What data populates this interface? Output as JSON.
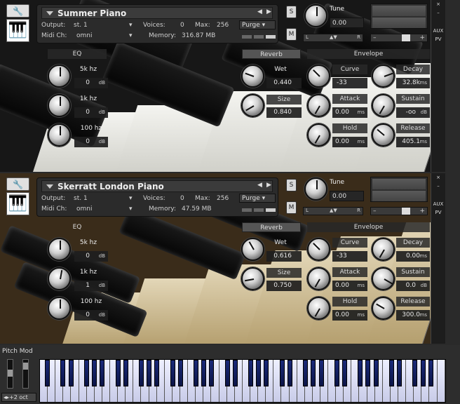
{
  "instruments": [
    {
      "name": "Summer Piano",
      "output": "st. 1",
      "midi_ch": "omni",
      "voices": "0",
      "max": "256",
      "memory": "316.87 MB",
      "purge": "Purge",
      "tune": "0.00",
      "eq": {
        "label": "EQ",
        "bands": [
          {
            "freq": "5k hz",
            "value": "0",
            "unit": "dB"
          },
          {
            "freq": "1k hz",
            "value": "0",
            "unit": "dB"
          },
          {
            "freq": "100 hz",
            "value": "0",
            "unit": "dB"
          }
        ]
      },
      "reverb": {
        "label": "Reverb",
        "wet": "0.440",
        "size": "0.840"
      },
      "curve": "-33",
      "attack": "0.00",
      "hold": "0.00",
      "envelope": {
        "label": "Envelope",
        "decay": "32.8k",
        "sustain": "-oo",
        "release": "405.1"
      }
    },
    {
      "name": "Skerratt London Piano",
      "output": "st. 1",
      "midi_ch": "omni",
      "voices": "0",
      "max": "256",
      "memory": "47.59 MB",
      "purge": "Purge",
      "tune": "0.00",
      "eq": {
        "label": "EQ",
        "bands": [
          {
            "freq": "5k hz",
            "value": "0",
            "unit": "dB"
          },
          {
            "freq": "1k hz",
            "value": "1",
            "unit": "dB"
          },
          {
            "freq": "100 hz",
            "value": "0",
            "unit": "dB"
          }
        ]
      },
      "reverb": {
        "label": "Reverb",
        "wet": "0.616",
        "size": "0.750"
      },
      "curve": "-33",
      "attack": "0.00",
      "hold": "0.00",
      "envelope": {
        "label": "Envelope",
        "decay": "0.00",
        "sustain": "0.0",
        "release": "300.0"
      }
    }
  ],
  "labels": {
    "output": "Output:",
    "midi": "Midi Ch:",
    "voices": "Voices:",
    "max": "Max:",
    "memory": "Memory:",
    "tune": "Tune",
    "wet": "Wet",
    "size": "Size",
    "curve": "Curve",
    "attack": "Attack",
    "hold": "Hold",
    "decay": "Decay",
    "sustain": "Sustain",
    "release": "Release",
    "ms": "ms",
    "db": "dB",
    "s": "S",
    "m": "M",
    "l": "L",
    "r": "R",
    "aux": "AUX",
    "pv": "PV",
    "close": "×",
    "minus": "–"
  },
  "keyboard": {
    "pitch_mod": "Pitch Mod",
    "octave": "+2 oct"
  }
}
